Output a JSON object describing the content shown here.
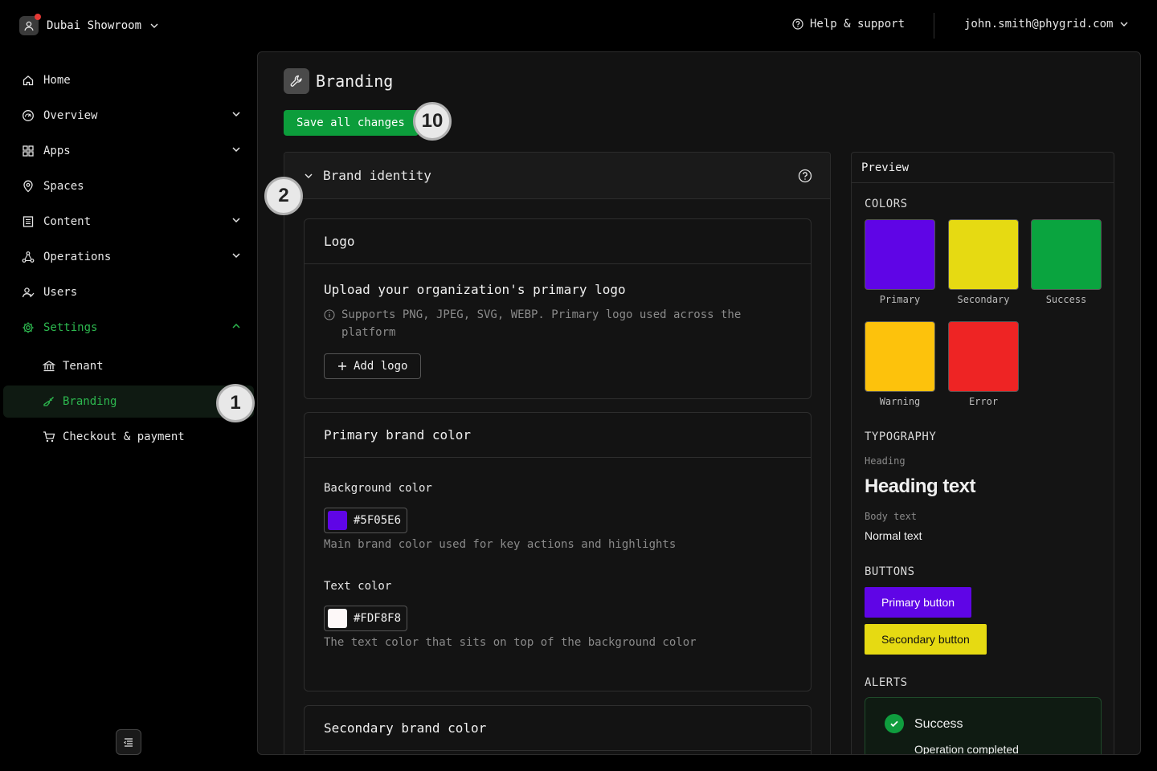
{
  "topbar": {
    "tenant_name": "Dubai Showroom",
    "help_label": "Help & support",
    "account_email": "john.smith@phygrid.com"
  },
  "sidebar": {
    "items": [
      {
        "label": "Home",
        "icon": "home-icon"
      },
      {
        "label": "Overview",
        "icon": "gauge-icon",
        "expandable": true
      },
      {
        "label": "Apps",
        "icon": "grid-icon",
        "expandable": true
      },
      {
        "label": "Spaces",
        "icon": "location-pin-icon"
      },
      {
        "label": "Content",
        "icon": "document-icon",
        "expandable": true
      },
      {
        "label": "Operations",
        "icon": "network-icon",
        "expandable": true
      },
      {
        "label": "Users",
        "icon": "users-icon"
      },
      {
        "label": "Settings",
        "icon": "gear-icon",
        "expanded": true,
        "active": true
      }
    ],
    "sub_items": [
      {
        "label": "Tenant",
        "icon": "bank-icon"
      },
      {
        "label": "Branding",
        "icon": "brush-icon",
        "active": true
      },
      {
        "label": "Checkout & payment",
        "icon": "cart-icon"
      }
    ]
  },
  "annotations": {
    "badge_1": "1",
    "badge_2": "2",
    "badge_10": "10"
  },
  "page": {
    "title": "Branding",
    "save_label": "Save all changes",
    "section_title": "Brand identity"
  },
  "logo_card": {
    "title": "Logo",
    "upload_title": "Upload your organization's primary logo",
    "upload_desc": "Supports PNG, JPEG, SVG, WEBP. Primary logo used across the platform",
    "add_label": "Add logo"
  },
  "primary_card": {
    "title": "Primary brand color",
    "bg_label": "Background color",
    "bg_value": "#5F05E6",
    "bg_help": "Main brand color used for key actions and highlights",
    "text_label": "Text color",
    "text_value": "#FDF8F8",
    "text_help": "The text color that sits on top of the background color"
  },
  "secondary_card": {
    "title": "Secondary brand color"
  },
  "preview": {
    "title": "Preview",
    "colors_heading": "COLORS",
    "colors": [
      {
        "label": "Primary",
        "hex": "#5F05E6"
      },
      {
        "label": "Secondary",
        "hex": "#E6DA12"
      },
      {
        "label": "Success",
        "hex": "#0AA43F"
      },
      {
        "label": "Warning",
        "hex": "#FDC20C"
      },
      {
        "label": "Error",
        "hex": "#EE2424"
      }
    ],
    "typography_heading": "TYPOGRAPHY",
    "heading_caption": "Heading",
    "heading_sample": "Heading text",
    "body_caption": "Body text",
    "body_sample": "Normal text",
    "buttons_heading": "BUTTONS",
    "primary_button": "Primary button",
    "secondary_button": "Secondary button",
    "alerts_heading": "ALERTS",
    "alert_title": "Success",
    "alert_message": "Operation completed"
  },
  "colors": {
    "accent_green": "#2DB84F",
    "save_green": "#0C9D3B"
  }
}
